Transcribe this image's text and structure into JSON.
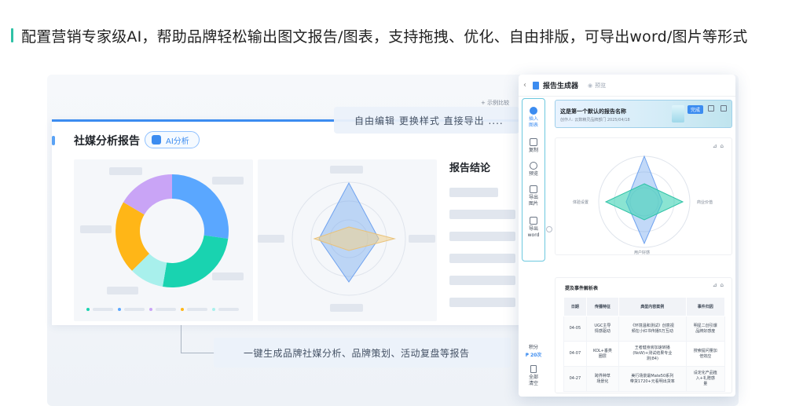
{
  "headline": "配置营销专家级AI，帮助品牌轻松输出图文报告/图表，支持拖拽、优化、自由排版，可导出word/图片等形式",
  "colors": {
    "accent_bar": "#2fc2a6",
    "primary": "#3c8cf0"
  },
  "report": {
    "title": "社媒分析报告",
    "ai_button": "AI分析",
    "conclusion_title": "报告结论",
    "donut_colors": [
      "#5aa7ff",
      "#19d3b0",
      "#a8f0ec",
      "#ffb617",
      "#c9a4f6"
    ]
  },
  "callouts": {
    "top": "自由编辑 更换样式 直接导出 ....",
    "bottom": "一键生成品牌社媒分析、品牌策划、活动复盘等报告"
  },
  "app": {
    "back_icon": "chevron-left-icon",
    "doc_name": "报告生成器",
    "preview_label": "预览",
    "peek_label": "+ 示例比较",
    "toolbar": [
      {
        "label": "插入\n图表",
        "icon": "plus-icon",
        "active": true
      },
      {
        "label": "复制",
        "icon": "copy-icon",
        "active": false
      },
      {
        "label": "预览",
        "icon": "eye-icon",
        "active": false
      },
      {
        "label": "导出\n图片",
        "icon": "image-icon",
        "active": false
      },
      {
        "label": "导出\nword",
        "icon": "word-icon",
        "active": false
      }
    ],
    "credits_label": "积分",
    "credits_value": "₱ 20次",
    "select_all": "全部\n清空",
    "banner": {
      "title": "这是第一个默认的报告名称",
      "subtitle": "创作人: 云数精灵品牌部门   2025/04/18",
      "done": "完成"
    },
    "radar_labels": {
      "left": "体验设置",
      "right": "商业价值",
      "bottom": "用户好感"
    },
    "table": {
      "title": "提及事件解析表",
      "headers": [
        "日期",
        "传播特征",
        "典型内容案例",
        "事件归因"
      ],
      "rows": [
        [
          "04-05",
          "UGC主导\n情感驱动",
          "《环境温和测试》创意视\n频在小红书传播5万互动",
          "明星二创引爆\n品牌好感度"
        ],
        [
          "04-07",
          "KOL+垂类\n圈层",
          "王者健身房加速转播\n(NoW)+测试结果专业\n测(84)",
          "搜索提问量加\n倍效应"
        ],
        [
          "04-27",
          "跨界种草\n场景化",
          "美行场景最Mate50系列\n带货1720+元看明出货率",
          "设定化产品植\n入+礼赠感\n量"
        ]
      ]
    }
  }
}
